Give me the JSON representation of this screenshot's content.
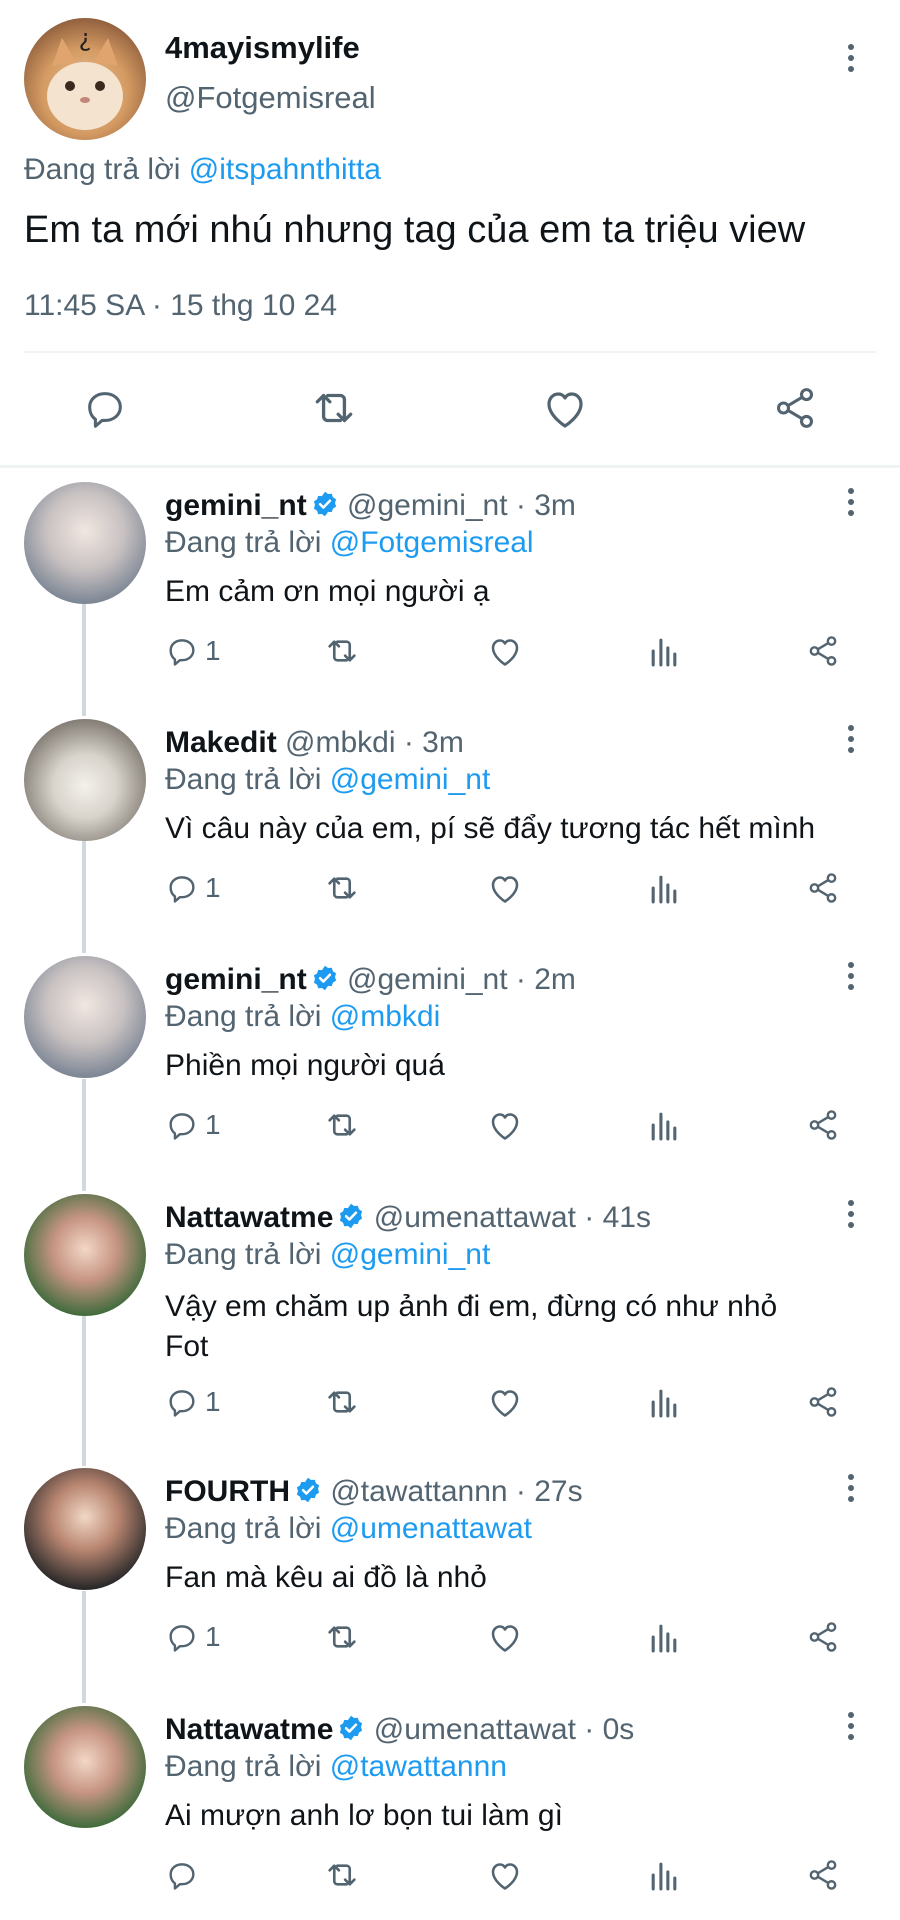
{
  "main_tweet": {
    "display_name": "4mayismylife",
    "handle": "@Fotgemisreal",
    "reply_prefix": "Đang trả lời",
    "reply_to": "@itspahnthitta",
    "text": "Em ta mới nhú nhưng tag của em ta triệu view",
    "timestamp": "11:45 SA · 15 thg 10 24"
  },
  "replies": [
    {
      "display_name": "gemini_nt",
      "verified": true,
      "meta": "@gemini_nt · 3m",
      "reply_prefix": "Đang trả lời",
      "reply_to": "@Fotgemisreal",
      "text": "Em cảm ơn mọi người ạ",
      "reply_count": "1"
    },
    {
      "display_name": "Makedit",
      "verified": false,
      "meta": "@mbkdi · 3m",
      "reply_prefix": "Đang trả lời",
      "reply_to": "@gemini_nt",
      "text": "Vì câu này của em, pí sẽ đẩy tương tác hết mình",
      "reply_count": "1"
    },
    {
      "display_name": "gemini_nt",
      "verified": true,
      "meta": "@gemini_nt · 2m",
      "reply_prefix": "Đang trả lời",
      "reply_to": "@mbkdi",
      "text": "Phiền mọi người quá",
      "reply_count": "1"
    },
    {
      "display_name": "Nattawatme",
      "verified": true,
      "meta": "@umenattawat · 41s",
      "reply_prefix": "Đang trả lời",
      "reply_to": "@gemini_nt",
      "text_line1": "Vậy em chăm up ảnh đi em, đừng có như nhỏ",
      "text_line2": "Fot",
      "reply_count": "1"
    },
    {
      "display_name": "FOURTH",
      "verified": true,
      "meta": "@tawattannn · 27s",
      "reply_prefix": "Đang trả lời",
      "reply_to": "@umenattawat",
      "text": "Fan mà kêu ai đồ là nhỏ",
      "reply_count": "1"
    },
    {
      "display_name": "Nattawatme",
      "verified": true,
      "meta": "@umenattawat · 0s",
      "reply_prefix": "Đang trả lời",
      "reply_to": "@tawattannn",
      "text": "Ai mượn anh lơ bọn tui làm gì",
      "reply_count": ""
    }
  ],
  "colors": {
    "accent": "#1d9bf0",
    "text": "#0f1419",
    "secondary": "#536471",
    "divider": "#eff3f4"
  },
  "icons": [
    "reply-icon",
    "retweet-icon",
    "like-icon",
    "views-icon",
    "share-icon",
    "more-icon",
    "verified-badge-icon"
  ]
}
